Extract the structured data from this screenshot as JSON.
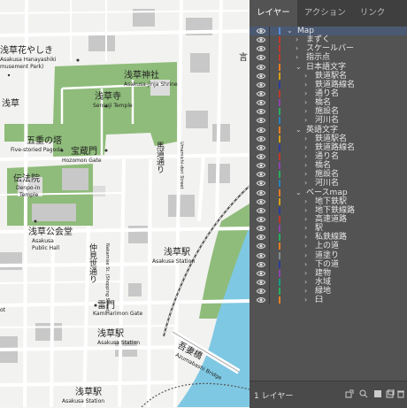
{
  "map": {
    "labels": {
      "hanayashiki_ja": "浅草花やしき",
      "hanayashiki_en": "Asakusa Hanayashiki",
      "hanayashiki_en2": "musement Park)",
      "shrine_ja": "浅草神社",
      "shrine_en": "Asakusa-jinja Shrine",
      "temple_ja": "浅草寺",
      "temple_en": "Sensoji Temple",
      "asakusa_left": "浅草",
      "pagoda_ja": "五重の塔",
      "pagoda_en": "Five-storied Pagoda",
      "hozomon_ja": "宝蔵門",
      "hozomon_en": "Hozomon Gate",
      "umamichi_ja": "馬道通り",
      "umamichi_en": "Umamichi-dori Street",
      "denpoin_ja": "伝法院",
      "denpoin_en1": "Denpo-in",
      "denpoin_en2": "Temple",
      "kokaido_ja": "浅草公会堂",
      "kokaido_en1": "Asakusa",
      "kokaido_en2": "Public Hall",
      "nakamise_ja": "仲見世通り",
      "nakamise_en": "Nakamise St. (Shopping Street)",
      "station_ja": "浅草駅",
      "station_en": "Asakusa Station",
      "kaminarimon_ja": "雷門",
      "kaminarimon_en": "Kaminarimon Gate",
      "station2_ja": "浅草駅",
      "station2_en": "Asakusa Station",
      "azumabashi_ja": "吾妻橋",
      "azumabashi_en": "Azumabashi Bridge",
      "station3_ja": "浅草駅",
      "station3_en": "Asakusa Station",
      "corner_top": "言",
      "corner_left": "ot"
    }
  },
  "panel": {
    "tabs": [
      "レイヤー",
      "アクション",
      "リンク"
    ],
    "layers": [
      {
        "name": "Map",
        "depth": 0,
        "expanded": true,
        "color": "#5a8cd6"
      },
      {
        "name": "まずく",
        "depth": 1,
        "expanded": false,
        "color": "#c0392b"
      },
      {
        "name": "スケールバー",
        "depth": 1,
        "expanded": false,
        "color": "#c0392b"
      },
      {
        "name": "指示点",
        "depth": 1,
        "expanded": false,
        "color": "#c0392b"
      },
      {
        "name": "日本語文字",
        "depth": 1,
        "expanded": true,
        "color": "#e67e22"
      },
      {
        "name": "鉄道駅名",
        "depth": 2,
        "expanded": false,
        "color": "#d4a017"
      },
      {
        "name": "鉄道路線名",
        "depth": 2,
        "expanded": false,
        "color": "#2c3e9e"
      },
      {
        "name": "通り名",
        "depth": 2,
        "expanded": false,
        "color": "#c0392b"
      },
      {
        "name": "橋名",
        "depth": 2,
        "expanded": false,
        "color": "#8e44ad"
      },
      {
        "name": "施設名",
        "depth": 2,
        "expanded": false,
        "color": "#27ae60"
      },
      {
        "name": "河川名",
        "depth": 2,
        "expanded": false,
        "color": "#2980b9"
      },
      {
        "name": "英語文字",
        "depth": 1,
        "expanded": true,
        "color": "#e67e22"
      },
      {
        "name": "鉄道駅名",
        "depth": 2,
        "expanded": false,
        "color": "#d4a017"
      },
      {
        "name": "鉄道路線名",
        "depth": 2,
        "expanded": false,
        "color": "#2c3e9e"
      },
      {
        "name": "通り名",
        "depth": 2,
        "expanded": false,
        "color": "#c0392b"
      },
      {
        "name": "橋名",
        "depth": 2,
        "expanded": false,
        "color": "#8e44ad"
      },
      {
        "name": "施設名",
        "depth": 2,
        "expanded": false,
        "color": "#27ae60"
      },
      {
        "name": "河川名",
        "depth": 2,
        "expanded": false,
        "color": "#2980b9"
      },
      {
        "name": "ベースmap",
        "depth": 1,
        "expanded": true,
        "color": "#e67e22"
      },
      {
        "name": "地下鉄駅",
        "depth": 2,
        "expanded": false,
        "color": "#d4a017"
      },
      {
        "name": "地下鉄線路",
        "depth": 2,
        "expanded": false,
        "color": "#2c3e9e"
      },
      {
        "name": "高速道路",
        "depth": 2,
        "expanded": false,
        "color": "#c0392b"
      },
      {
        "name": "駅",
        "depth": 2,
        "expanded": false,
        "color": "#8e44ad"
      },
      {
        "name": "私鉄線路",
        "depth": 2,
        "expanded": false,
        "color": "#27ae60"
      },
      {
        "name": "上の道",
        "depth": 2,
        "expanded": false,
        "color": "#e67e22"
      },
      {
        "name": "道塗り",
        "depth": 2,
        "expanded": false,
        "color": "#7f8c8d"
      },
      {
        "name": "下の道",
        "depth": 2,
        "expanded": false,
        "color": "#2c3e9e"
      },
      {
        "name": "建物",
        "depth": 2,
        "expanded": false,
        "color": "#8e44ad"
      },
      {
        "name": "水域",
        "depth": 2,
        "expanded": false,
        "color": "#16a085"
      },
      {
        "name": "緑地",
        "depth": 2,
        "expanded": false,
        "color": "#27ae60"
      },
      {
        "name": "臼",
        "depth": 2,
        "expanded": false,
        "color": "#e67e22"
      }
    ],
    "footer": {
      "count": "1 レイヤー"
    }
  },
  "colors": {
    "panel_bg": "#535353",
    "tab_bar": "#3f3f3f",
    "selected_row": "#4b5a72",
    "park": "#8fbc7a",
    "river": "#7ec8e3",
    "building": "#c8c8c8"
  }
}
